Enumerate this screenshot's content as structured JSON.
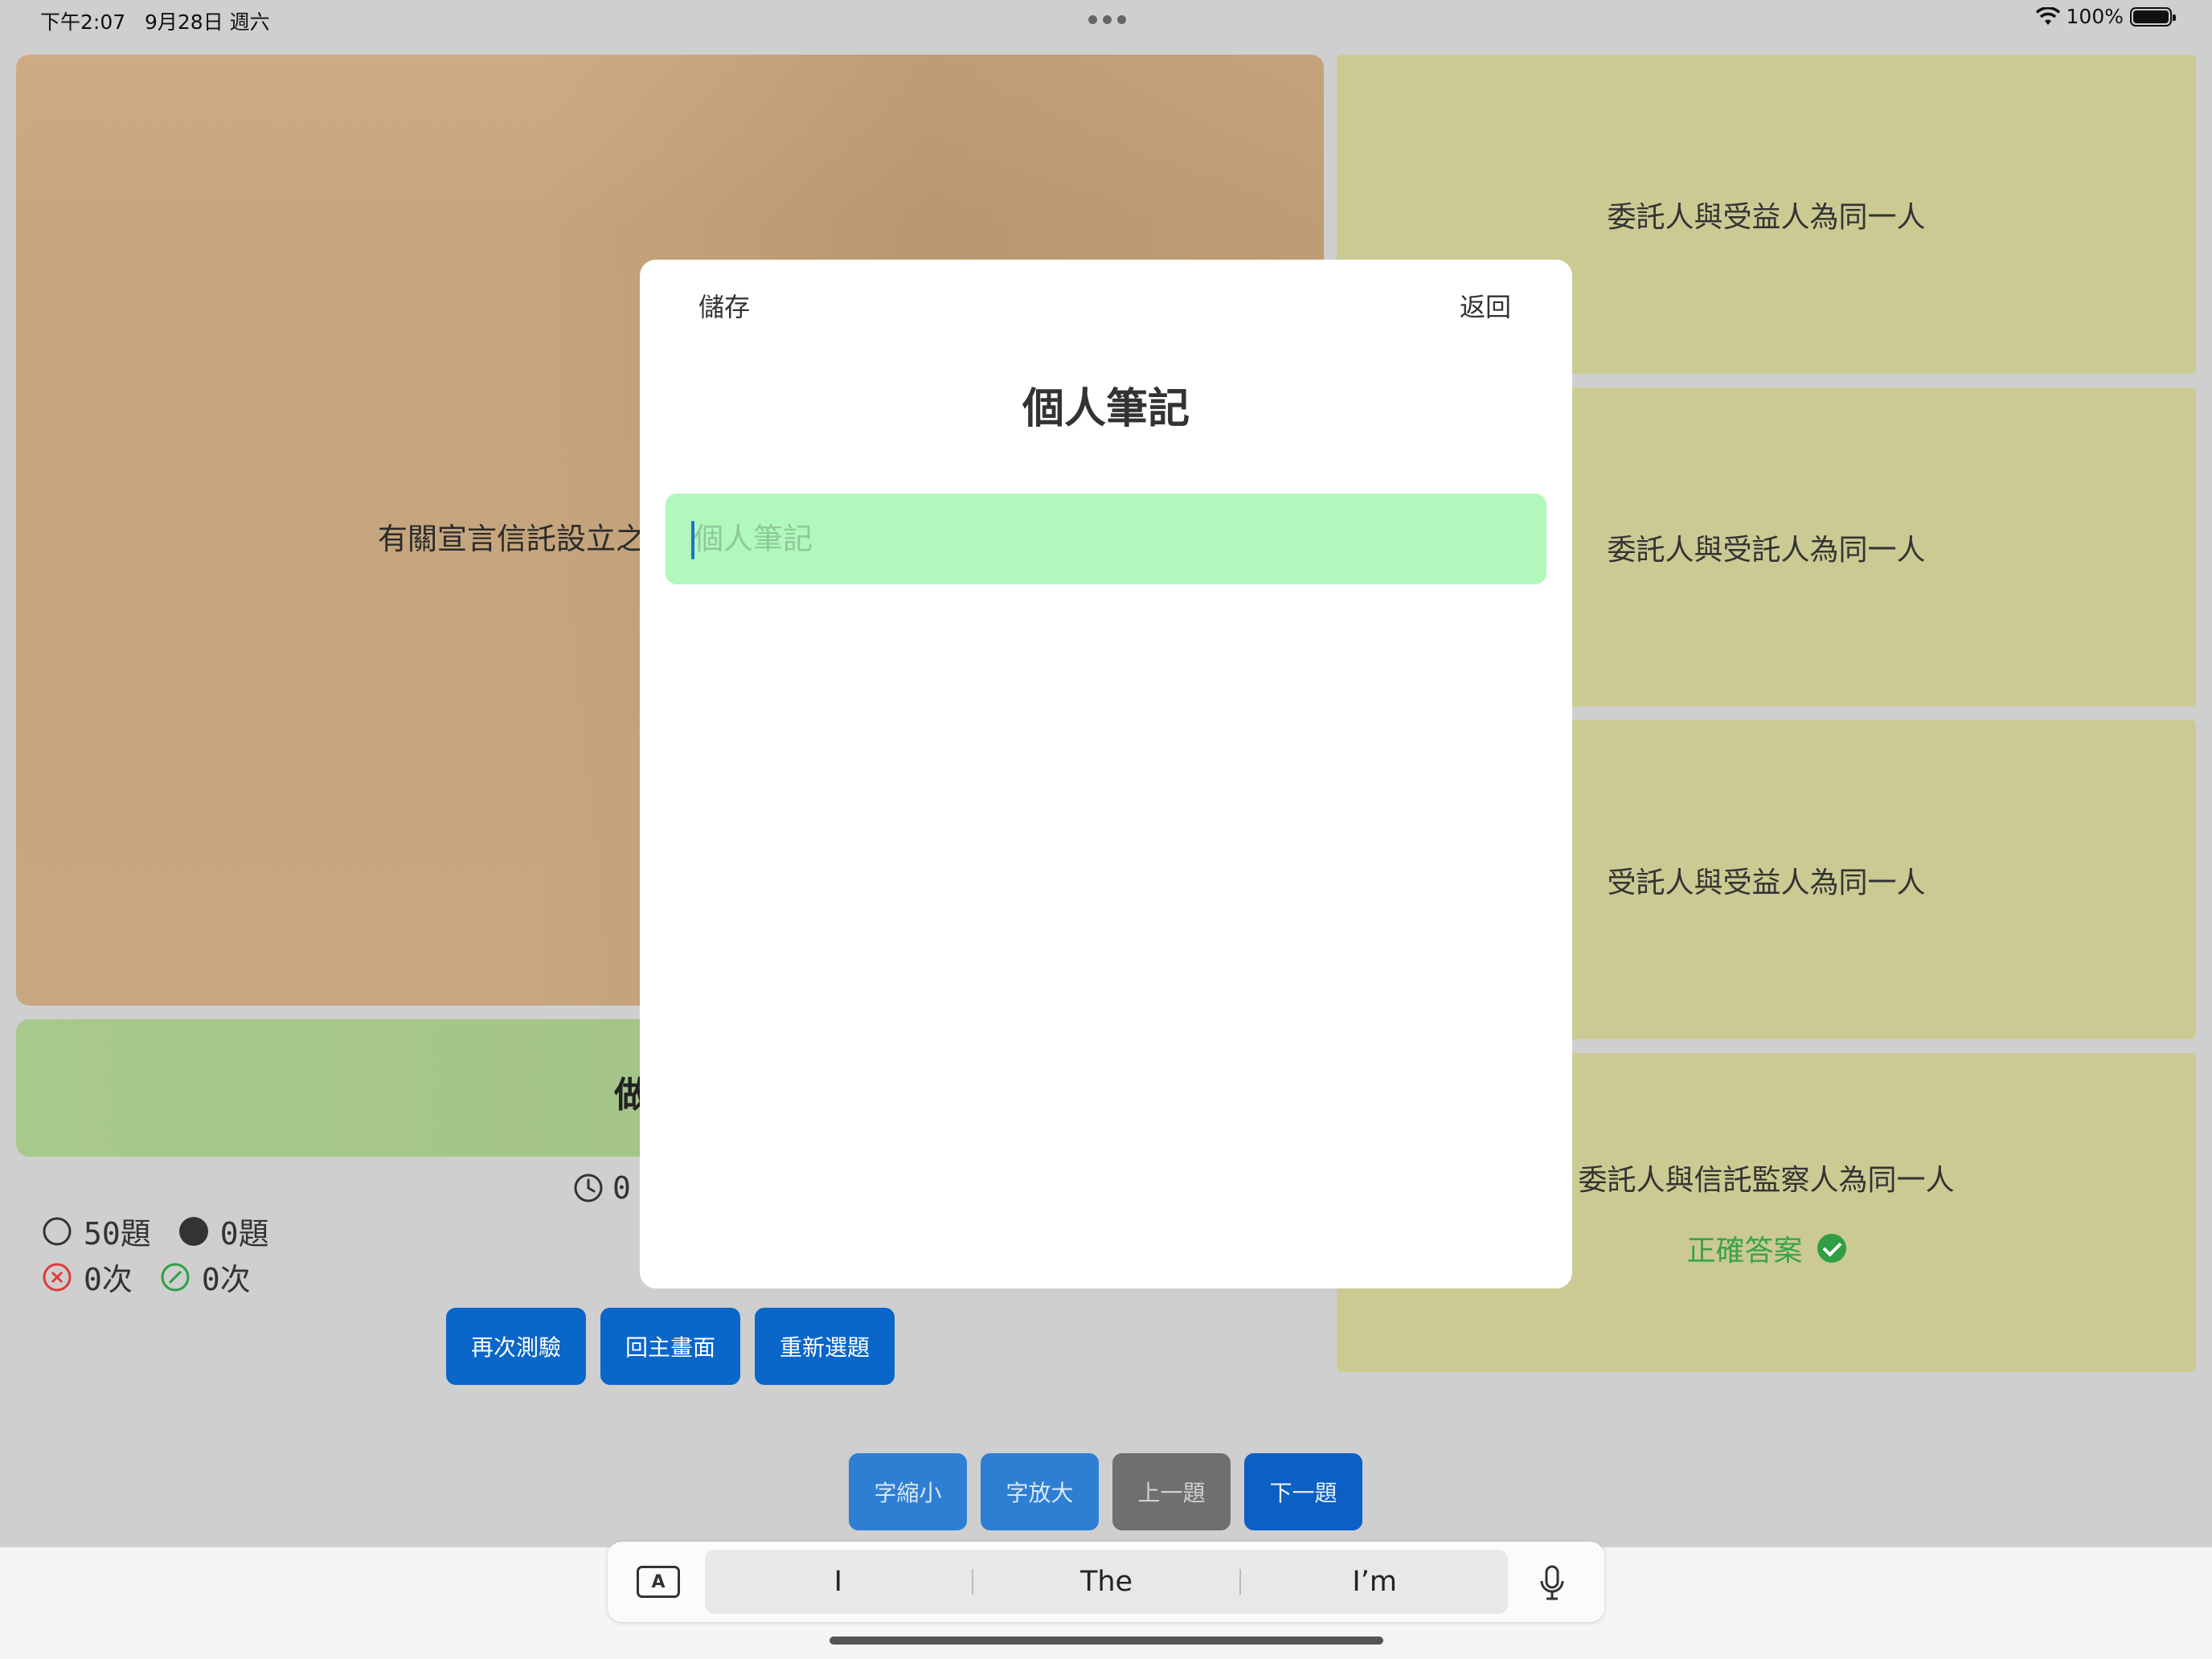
{
  "status_bar": {
    "time": "下午2:07",
    "date": "9月28日 週六",
    "battery": "100%",
    "wifi_icon": "wifi-icon",
    "battery_icon": "battery-icon"
  },
  "question": {
    "text": "有關宣言信託設立之"
  },
  "answer_bar": {
    "text": "做"
  },
  "timer": {
    "value": "0"
  },
  "stats": {
    "unanswered": "50題",
    "answered": "0題",
    "wrong": "0次",
    "correct": "0次"
  },
  "actions": {
    "retest": "再次測驗",
    "home": "回主畫面",
    "reselect": "重新選題"
  },
  "options": [
    {
      "text": "委託人與受益人為同一人"
    },
    {
      "text": "委託人與受託人為同一人"
    },
    {
      "text": "受託人與受益人為同一人"
    },
    {
      "text": "委託人與信託監察人為同一人",
      "badge": "正確答案"
    }
  ],
  "bottom_buttons": {
    "font_smaller": "字縮小",
    "font_larger": "字放大",
    "prev": "上一題",
    "next": "下一題"
  },
  "modal": {
    "save": "儲存",
    "back": "返回",
    "title": "個人筆記",
    "note_value": "",
    "note_placeholder": "個人筆記"
  },
  "keyboard": {
    "suggestions": [
      "I",
      "The",
      "I’m"
    ],
    "format_label": "A"
  },
  "colors": {
    "question_bg": "#c7a680",
    "option_bg": "#cbca93",
    "answer_bar_bg": "#a3c389",
    "primary_button": "#0a66c8",
    "note_field_bg": "#b1f8bd",
    "correct_green": "#3aa24a"
  }
}
